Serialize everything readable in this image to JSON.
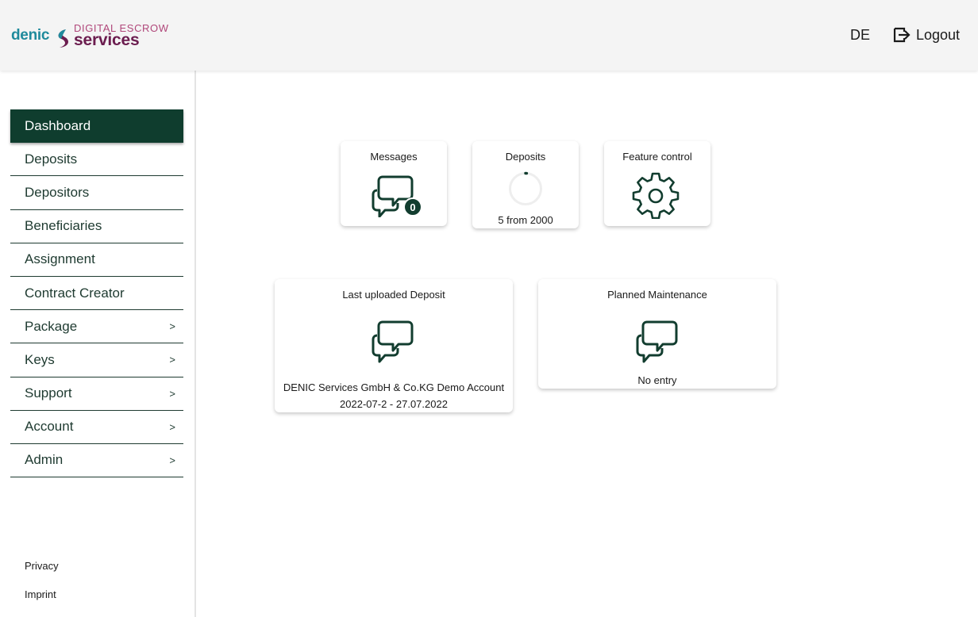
{
  "brand": {
    "name_left": "denic",
    "tagline": "DIGITAL ESCROW",
    "name_right": "services"
  },
  "header": {
    "language": "DE",
    "logout_label": "Logout"
  },
  "sidebar": {
    "items": [
      {
        "label": "Dashboard",
        "active": true,
        "has_submenu": false
      },
      {
        "label": "Deposits",
        "active": false,
        "has_submenu": false
      },
      {
        "label": "Depositors",
        "active": false,
        "has_submenu": false
      },
      {
        "label": "Beneficiaries",
        "active": false,
        "has_submenu": false
      },
      {
        "label": "Assignment",
        "active": false,
        "has_submenu": false
      },
      {
        "label": "Contract Creator",
        "active": false,
        "has_submenu": false
      },
      {
        "label": "Package",
        "active": false,
        "has_submenu": true
      },
      {
        "label": "Keys",
        "active": false,
        "has_submenu": true
      },
      {
        "label": "Support",
        "active": false,
        "has_submenu": true
      },
      {
        "label": "Account",
        "active": false,
        "has_submenu": true
      },
      {
        "label": "Admin",
        "active": false,
        "has_submenu": true
      }
    ],
    "submenu_indicator": ">",
    "footer": {
      "privacy": "Privacy",
      "imprint": "Imprint"
    }
  },
  "dashboard": {
    "messages": {
      "title": "Messages",
      "count": "0"
    },
    "deposits": {
      "title": "Deposits",
      "used": 5,
      "limit": 2000,
      "caption": "5 from 2000"
    },
    "feature_control": {
      "title": "Feature control"
    },
    "last_uploaded": {
      "title": "Last uploaded Deposit",
      "account": "DENIC Services GmbH & Co.KG Demo Account",
      "period": "2022-07-2 - 27.07.2022"
    },
    "maintenance": {
      "title": "Planned Maintenance",
      "status": "No entry"
    }
  },
  "colors": {
    "primary": "#0f3d2e",
    "brand_teal": "#1f8a9c",
    "brand_plum": "#6b1d4f",
    "brand_pink": "#b0477a",
    "header_bg": "#f4f4f4"
  },
  "icons": {
    "messages": "chat-bubbles-icon",
    "deposits": "progress-ring-icon",
    "feature_control": "gear-icon",
    "last_uploaded": "chat-bubbles-icon",
    "maintenance": "chat-bubbles-icon",
    "logout": "logout-icon"
  }
}
